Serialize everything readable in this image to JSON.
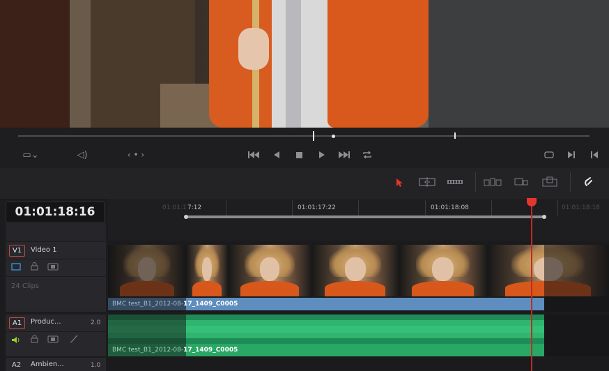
{
  "timecode": "01:01:18:16",
  "ruler": {
    "labels": [
      {
        "text": "01:01:1",
        "dim": true
      },
      {
        "text": "7:12",
        "dim": false
      },
      {
        "text": "01:01:17:22",
        "dim": false
      },
      {
        "text": "01:01:18:08",
        "dim": false
      },
      {
        "text": "01:01:18:18",
        "dim": true
      }
    ]
  },
  "transport": {
    "icons": [
      "viewer-options-icon",
      "audio-icon",
      "prev-marker-icon",
      "next-marker-icon",
      "go-to-start-icon",
      "play-reverse-icon",
      "stop-icon",
      "play-icon",
      "go-to-end-icon",
      "loop-icon",
      "match-frame-icon",
      "mark-in-icon",
      "mark-out-icon"
    ],
    "viewer_dropdown": "▭⌄",
    "audio_glyph": "◁)",
    "marker_nav": "‹ • ›"
  },
  "edit_toolbar": {
    "icons": [
      "pointer-icon",
      "trim-icon",
      "blade-icon",
      "insert-icon",
      "overwrite-icon",
      "replace-icon",
      "snapping-icon"
    ]
  },
  "tracks": {
    "video": [
      {
        "id": "V1",
        "name": "Video 1",
        "info": "24 Clips",
        "clip_name_dim": "BMC test_B1_2012-08-",
        "clip_name": "17_1409_C0005"
      }
    ],
    "audio": [
      {
        "id": "A1",
        "name": "Produc...",
        "volume": "2.0",
        "clip_name_dim": "BMC test_B1_2012-08-",
        "clip_name": "17_1409_C0005"
      },
      {
        "id": "A2",
        "name": "Ambien...",
        "volume": "1.0"
      }
    ]
  },
  "colors": {
    "playhead": "#e5362d",
    "video_clip": "#5e8ebf",
    "audio_clip": "#1f8c57",
    "track_badge_border": "#c04a43",
    "active_pointer": "#e5362d"
  }
}
